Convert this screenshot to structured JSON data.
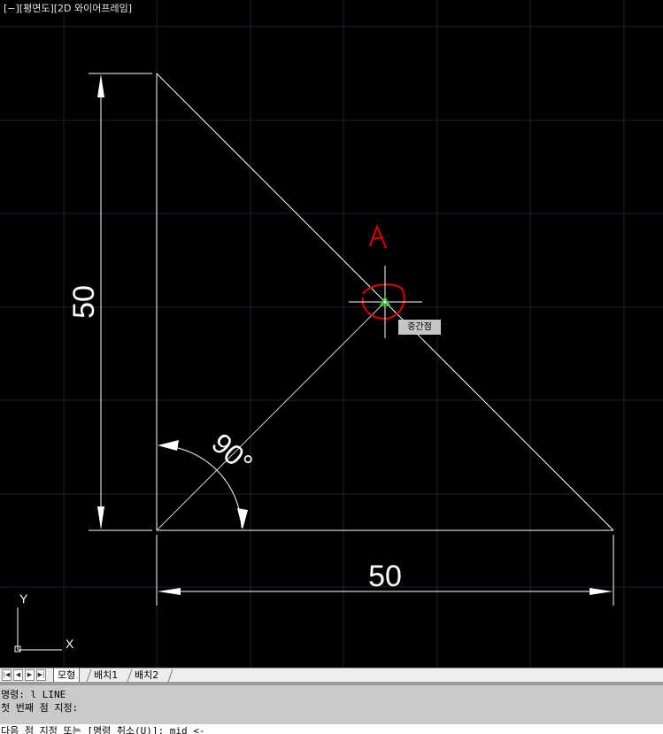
{
  "viewport": {
    "label": "[−][평면도][2D 와이어프레임]",
    "background": "#000000",
    "drawing_color": "#ffffff",
    "annotation_color": "#e00000"
  },
  "drawing": {
    "dimension_vertical": "50",
    "dimension_horizontal": "50",
    "angle_label": "90°",
    "annotation_text": "A",
    "snap_tooltip": "중간점",
    "ucs_y": "Y",
    "ucs_x": "X"
  },
  "tabs": {
    "model": "모형",
    "layout1": "배치1",
    "layout2": "배치2"
  },
  "command": {
    "line1": "명령: l LINE",
    "line2": "첫 번째 점 지정:",
    "prompt": "다음 점 지정 또는 [명령 취소(U)]: mid <-"
  }
}
